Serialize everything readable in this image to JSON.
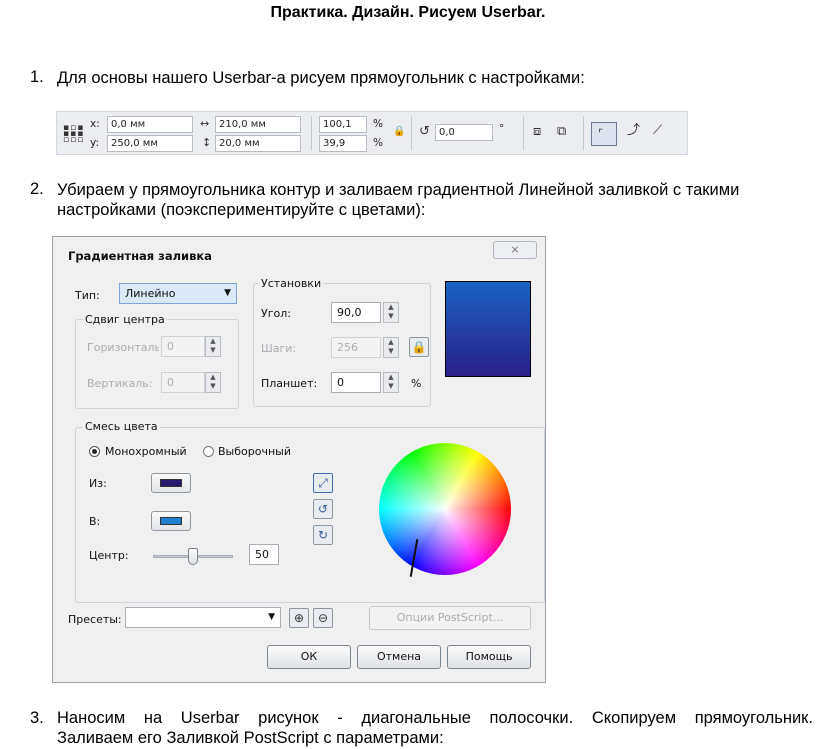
{
  "doc": {
    "title": "Практика. Дизайн. Рисуем Userbar.",
    "step1_num": "1.",
    "step1": "Для основы нашего Userbar-а рисуем прямоугольник с настройками:",
    "step2_num": "2.",
    "step2_line1": "Убираем у прямоугольника контур и заливаем градиентной Линейной заливкой с такими",
    "step2_line2": "настройками (поэкспериментируйте с цветами):",
    "step3_num": "3.",
    "step3_line1": "Наносим на Userbar рисунок - диагональные полосочки. Скопируем прямоугольник.",
    "step3_line2": "Заливаем его Заливкой PostScript с параметрами:"
  },
  "toolbar": {
    "x_label": "x:",
    "x_value": "0,0 мм",
    "y_label": "y:",
    "y_value": "250,0 мм",
    "w_value": "210,0 мм",
    "h_value": "20,0 мм",
    "scale_x": "100,1",
    "scale_y": "39,9",
    "pct1": "%",
    "pct2": "%",
    "rotation": "0,0",
    "degree": "°"
  },
  "dialog": {
    "title": "Градиентная заливка",
    "close": "⨯",
    "type_label": "Тип:",
    "type_value": "Линейно",
    "center_group": "Сдвиг центра",
    "horizontal_label": "Горизонталь:",
    "horizontal_value": "0",
    "vertical_label": "Вертикаль:",
    "vertical_value": "0",
    "settings_group": "Установки",
    "angle_label": "Угол:",
    "angle_value": "90,0",
    "steps_label": "Шаги:",
    "steps_value": "256",
    "pad_label": "Планшет:",
    "pad_value": "0",
    "pad_unit": "%",
    "blend_group": "Смесь цвета",
    "mono_label": "Монохромный",
    "custom_label": "Выборочный",
    "from_label": "Из:",
    "to_label": "В:",
    "center_label": "Центр:",
    "center_value": "50",
    "presets_label": "Пресеты:",
    "postscript_btn": "Опции PostScript...",
    "ok_btn": "ОК",
    "cancel_btn": "Отмена",
    "help_btn": "Помощь"
  },
  "colors": {
    "from_color": "#2a1a6e",
    "to_color": "#1f7fd0",
    "preview_top": "#1a62c4",
    "preview_bottom": "#2b1f8c"
  },
  "ui_state": {
    "center_slider_percent": 50,
    "mono_selected": true
  }
}
